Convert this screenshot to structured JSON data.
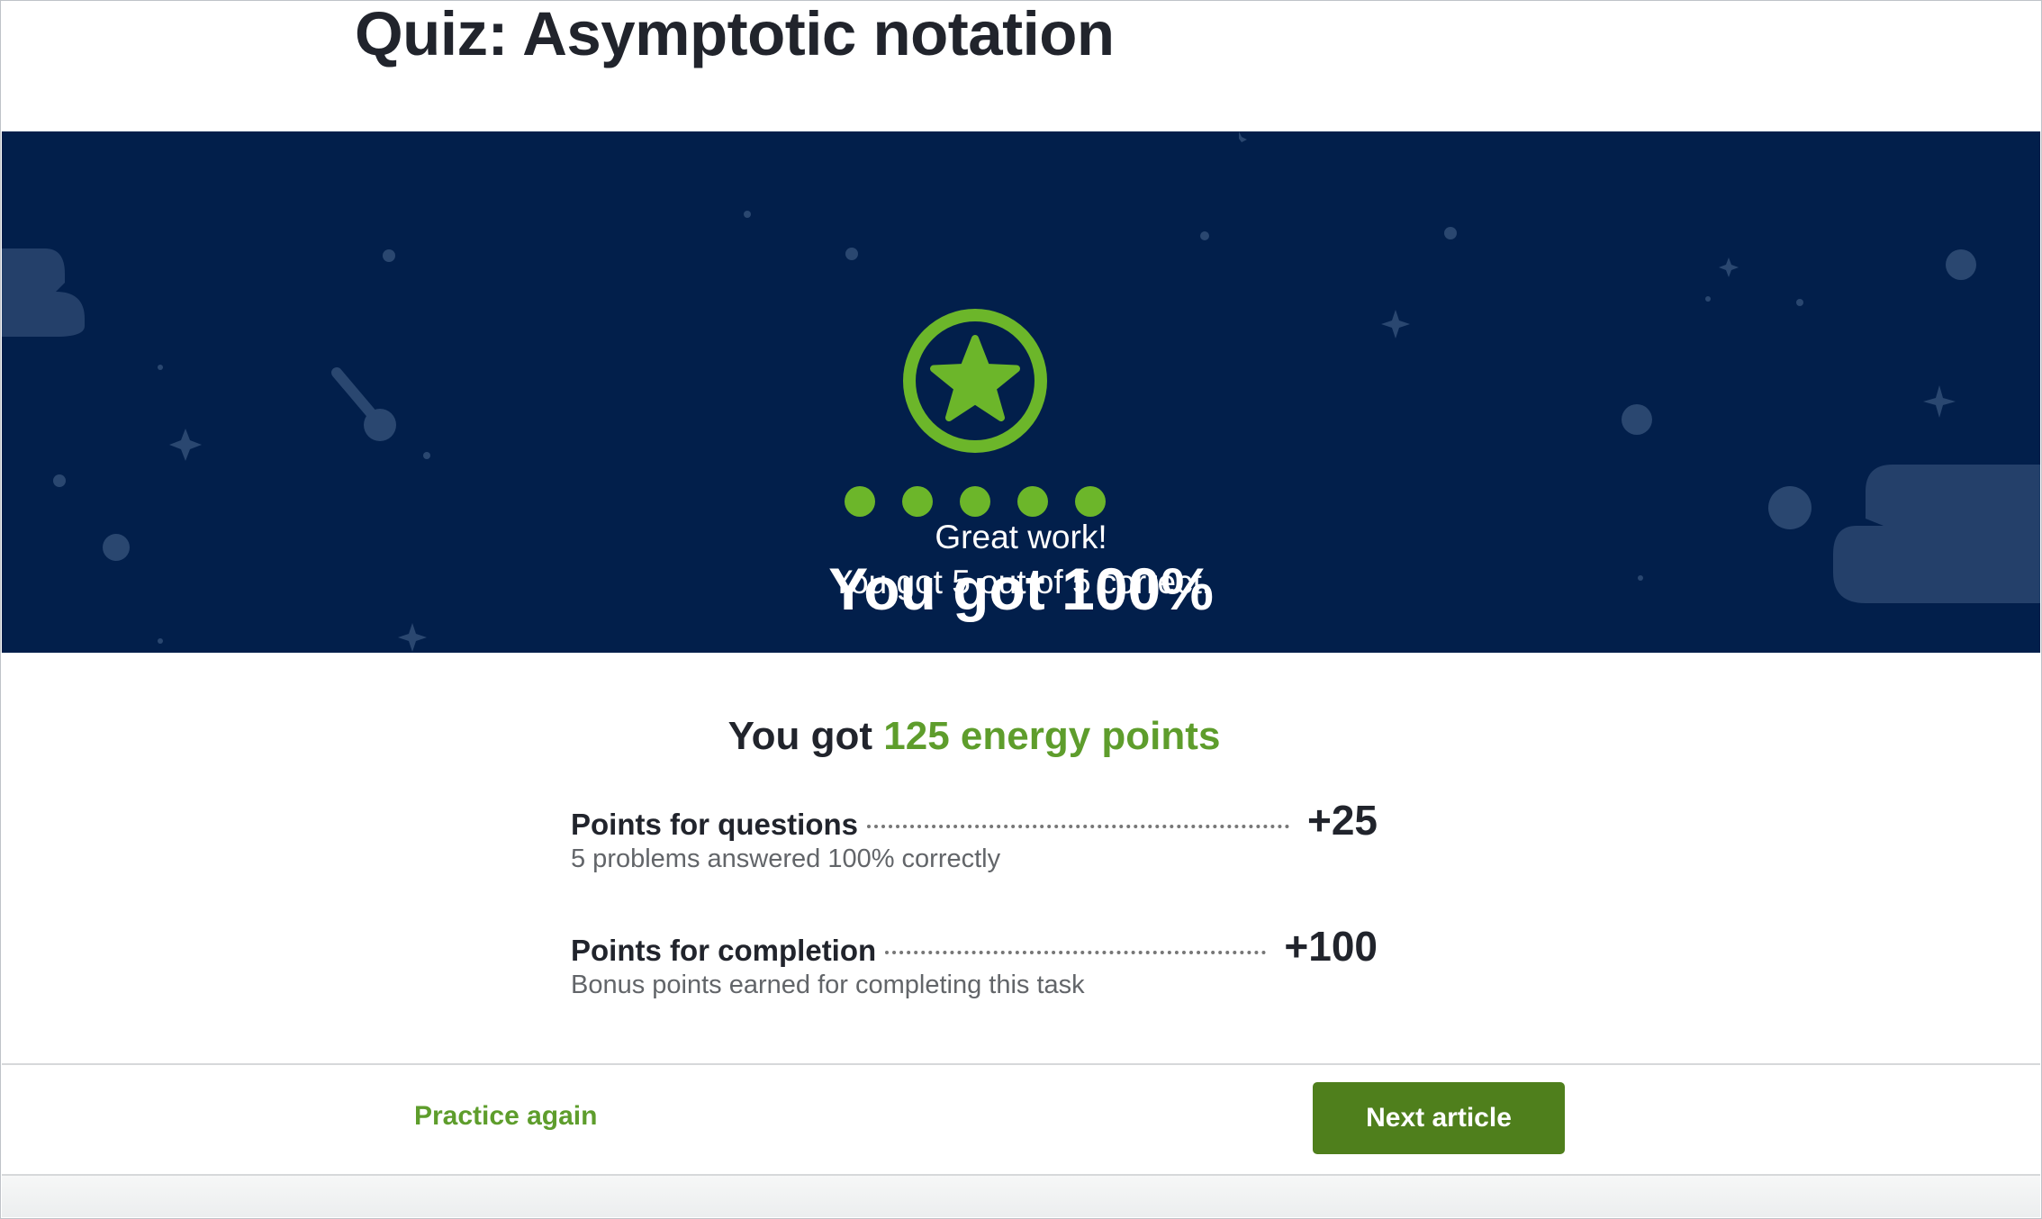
{
  "quiz": {
    "title": "Quiz: Asymptotic notation"
  },
  "result": {
    "heading": "You got 100%",
    "message_line1": "Great work!",
    "message_line2": "You got 5 out of 5 correct.",
    "correct": 5,
    "total": 5,
    "badge_icon": "star-icon",
    "progress_dots_icon": "dot-icon",
    "colors": {
      "banner_background": "#021f4b",
      "accent_green": "#6cb62a"
    }
  },
  "energy": {
    "prefix": "You got",
    "amount_text": "125 energy points",
    "accent_color": "#5e9d2c",
    "rows": [
      {
        "label": "Points for questions",
        "value": "+25",
        "description": "5 problems answered 100% correctly"
      },
      {
        "label": "Points for completion",
        "value": "+100",
        "description": "Bonus points earned for completing this task"
      }
    ]
  },
  "actions": {
    "practice_again": "Practice again",
    "next_article": "Next article",
    "button_color": "#4f7f1c"
  }
}
